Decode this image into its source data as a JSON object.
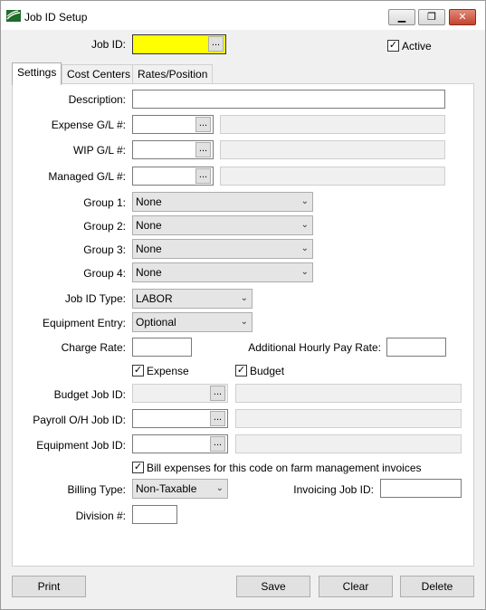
{
  "window": {
    "title": "Job ID Setup",
    "min_glyph": "▁",
    "max_glyph": "❐",
    "close_glyph": "✕"
  },
  "header": {
    "job_id_label": "Job ID:",
    "job_id_value": "",
    "lookup_glyph": "...",
    "active_label": "Active",
    "active_checked": true,
    "check_glyph": "✓"
  },
  "tabs": [
    {
      "label": "Settings"
    },
    {
      "label": "Cost Centers"
    },
    {
      "label": "Rates/Position"
    }
  ],
  "settings": {
    "description_label": "Description:",
    "description_value": "",
    "expense_gl_label": "Expense G/L #:",
    "wip_gl_label": "WIP G/L #:",
    "managed_gl_label": "Managed G/L #:",
    "group1_label": "Group 1:",
    "group1_value": "None",
    "group2_label": "Group 2:",
    "group2_value": "None",
    "group3_label": "Group 3:",
    "group3_value": "None",
    "group4_label": "Group 4:",
    "group4_value": "None",
    "job_id_type_label": "Job ID Type:",
    "job_id_type_value": "LABOR",
    "equipment_entry_label": "Equipment Entry:",
    "equipment_entry_value": "Optional",
    "charge_rate_label": "Charge Rate:",
    "charge_rate_value": "",
    "additional_hourly_label": "Additional Hourly Pay Rate:",
    "additional_hourly_value": "",
    "expense_check_label": "Expense",
    "expense_checked": true,
    "budget_check_label": "Budget",
    "budget_checked": true,
    "budget_job_label": "Budget Job ID:",
    "payroll_oh_label": "Payroll O/H Job ID:",
    "equipment_job_label": "Equipment Job ID:",
    "bill_expenses_label": "Bill expenses for this code on farm management invoices",
    "bill_expenses_checked": true,
    "billing_type_label": "Billing Type:",
    "billing_type_value": "Non-Taxable",
    "invoicing_job_label": "Invoicing Job ID:",
    "invoicing_job_value": "",
    "division_label": "Division #:",
    "division_value": "",
    "dropdown_glyph": "⌄"
  },
  "buttons": {
    "print": "Print",
    "save": "Save",
    "clear": "Clear",
    "delete": "Delete"
  }
}
